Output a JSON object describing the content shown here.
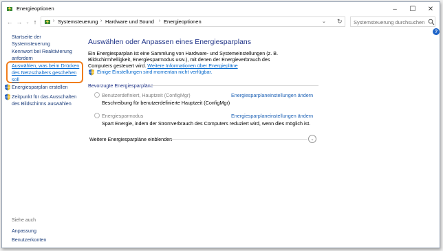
{
  "window": {
    "title": "Energieoptionen",
    "minimize": "–",
    "maximize": "☐",
    "close": "✕"
  },
  "navigation": {
    "back": "←",
    "forward": "→",
    "recent": "⌄",
    "up": "↑",
    "breadcrumbs": [
      "Systemsteuerung",
      "Hardware und Sound",
      "Energieoptionen"
    ],
    "separator": "›",
    "dropdown": "⌄",
    "refresh": "↻",
    "search_placeholder": "Systemsteuerung durchsuchen",
    "help": "?"
  },
  "sidebar": {
    "home": "Startseite der Systemsteuerung",
    "links": [
      "Kennwort bei Reaktivierung anfordern",
      "Auswählen, was beim Drücken des Netzschalters geschehen soll",
      "Energiesparplan erstellen",
      "Zeitpunkt für das Ausschalten des Bildschirms auswählen"
    ],
    "see_also_heading": "Siehe auch",
    "see_also": [
      "Anpassung",
      "Benutzerkonten"
    ],
    "highlight_color": "#f07d1c"
  },
  "main": {
    "title": "Auswählen oder Anpassen eines Energiesparplans",
    "intro_text": "Ein Energiesparplan ist eine Sammlung von Hardware- und Systemeinstellungen (z. B. Bildschirmhelligkeit, Energiesparmodus usw.), mit denen der Energieverbrauch des Computers gesteuert wird. ",
    "intro_link": "Weitere Informationen über Energiepläne",
    "notice": "Einige Einstellungen sind momentan nicht verfügbar.",
    "group_label": "Bevorzugte Energiesparpläne",
    "plans": [
      {
        "name": "Benutzerdefiniert, Hauptzeit (ConfigMgr)",
        "link": "Energiesparplaneinstellungen ändern",
        "description": "Beschreibung für benutzerdefinierte Hauptzeit (ConfigMgr)"
      },
      {
        "name": "Energiesparmodus",
        "link": "Energiesparplaneinstellungen ändern",
        "description": "Spart Energie, indem der Stromverbrauch des Computers reduziert wird, wenn dies möglich ist."
      }
    ],
    "more_plans": "Weitere Energiesparpläne einblenden",
    "expand": "⌄"
  }
}
